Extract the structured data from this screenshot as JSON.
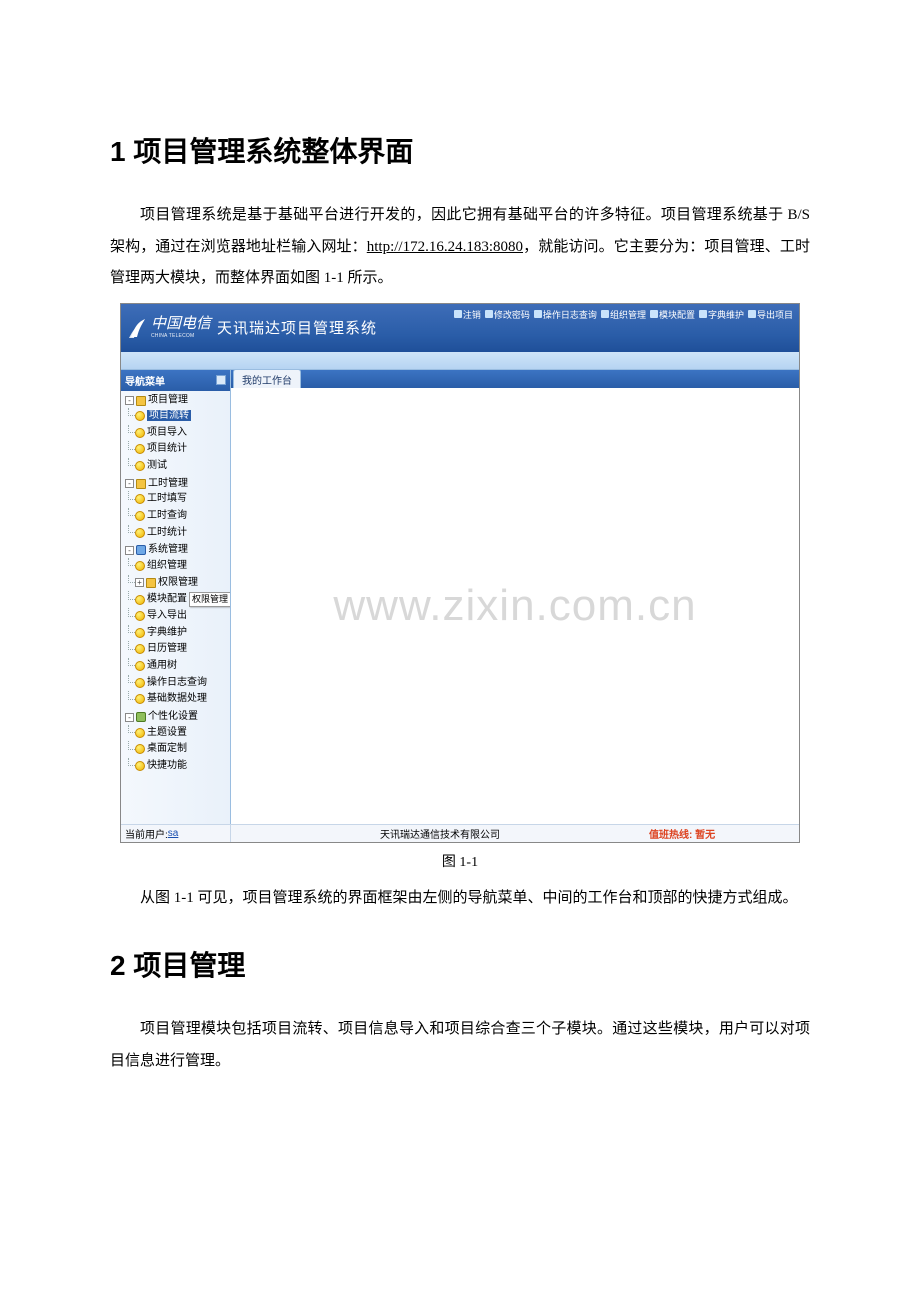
{
  "doc": {
    "heading1": "1 项目管理系统整体界面",
    "para1a": "项目管理系统是基于基础平台进行开发的，因此它拥有基础平台的许多特征。项目管理系统基于 B/S 架构，通过在浏览器地址栏输入网址：",
    "url": "http://172.16.24.183:8080",
    "para1b": "，就能访问。它主要分为：项目管理、工时管理两大模块，而整体界面如图 1-1 所示。",
    "figcaption": "图 1-1",
    "para2": "从图 1-1 可见，项目管理系统的界面框架由左侧的导航菜单、中间的工作台和顶部的快捷方式组成。",
    "heading2": "2 项目管理",
    "para3": "项目管理模块包括项目流转、项目信息导入和项目综合查三个子模块。通过这些模块，用户可以对项目信息进行管理。"
  },
  "app": {
    "brand_cn": "中国电信",
    "brand_en": "CHINA TELECOM",
    "title": "天讯瑞达项目管理系统",
    "header_links": [
      "注销",
      "修改密码",
      "操作日志查询",
      "组织管理",
      "模块配置",
      "字典维护",
      "导出项目"
    ],
    "sidebar_title": "导航菜单",
    "tab_label": "我的工作台",
    "tree": {
      "pm": {
        "label": "项目管理",
        "children": {
          "flow": "项目流转",
          "import": "项目导入",
          "stat": "项目统计",
          "test": "测试"
        }
      },
      "wh": {
        "label": "工时管理",
        "children": {
          "fill": "工时填写",
          "query": "工时查询",
          "stat": "工时统计"
        }
      },
      "sys": {
        "label": "系统管理",
        "children": {
          "org": "组织管理",
          "perm": "权限管理",
          "module": "模块配置",
          "io": "导入导出",
          "dict": "字典维护",
          "cal": "日历管理",
          "tree": "通用树",
          "log": "操作日志查询",
          "data": "基础数据处理"
        }
      },
      "pers": {
        "label": "个性化设置",
        "children": {
          "theme": "主题设置",
          "desk": "桌面定制",
          "quick": "快捷功能"
        }
      }
    },
    "tooltip_perm": "权限管理",
    "status": {
      "user_label": "当前用户:",
      "user": "sa",
      "company": "天讯瑞达通信技术有限公司",
      "hotline_label": "值班热线:",
      "hotline_value": "暂无"
    },
    "watermark": "www.zixin.com.cn"
  }
}
